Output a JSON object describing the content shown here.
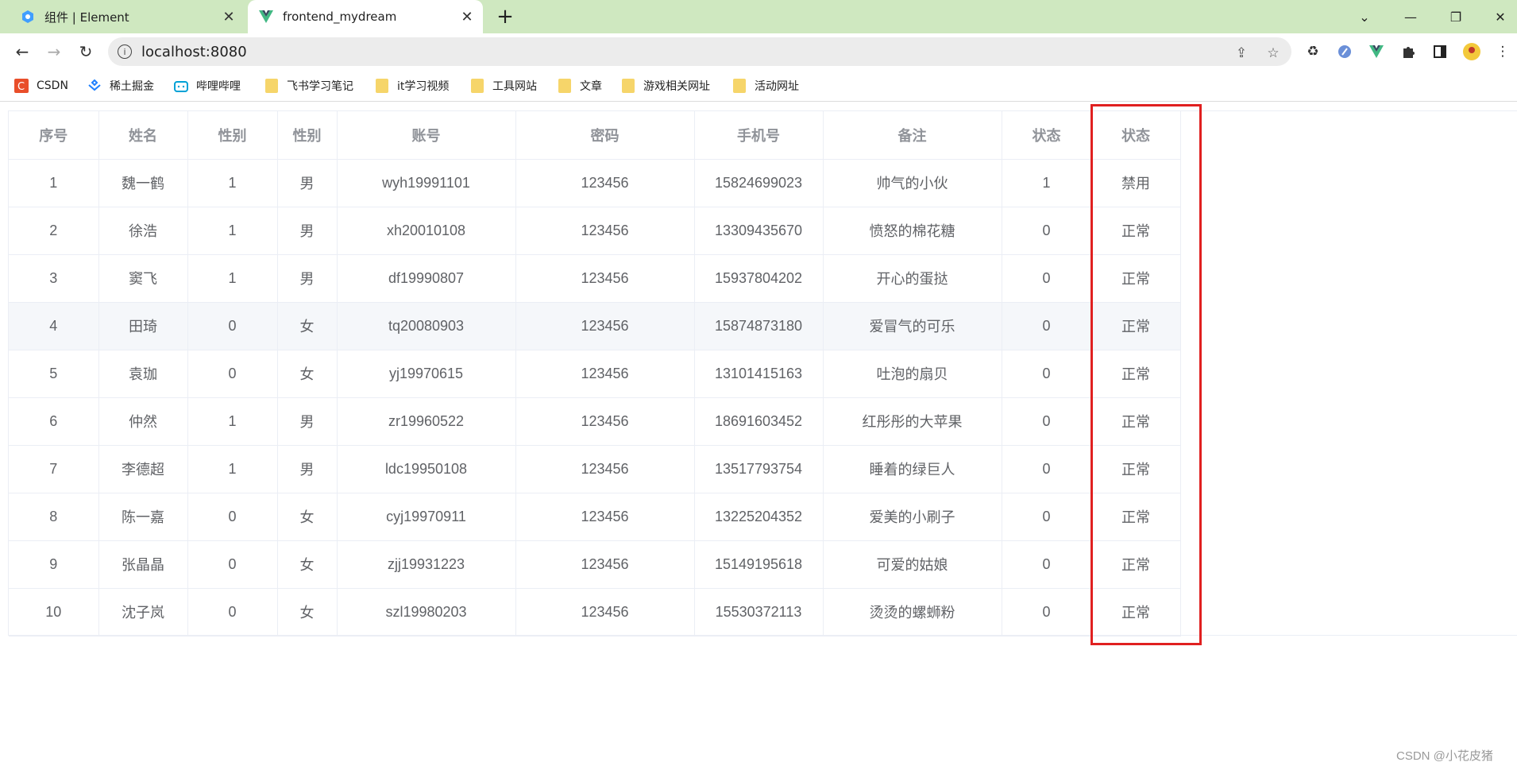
{
  "browser": {
    "tabs": [
      {
        "title": "组件 | Element",
        "close": "✕"
      },
      {
        "title": "frontend_mydream",
        "close": "✕"
      }
    ],
    "new_tab": "+",
    "window_controls": {
      "menu": "⌄",
      "minimize": "—",
      "restore": "❐",
      "close": "✕"
    },
    "nav": {
      "back": "←",
      "forward": "→",
      "reload": "↻"
    },
    "url": "localhost:8080",
    "bookmarks": [
      {
        "label": "CSDN",
        "icon": "csdn-icon"
      },
      {
        "label": "稀土掘金",
        "icon": "juejin-icon"
      },
      {
        "label": "哔哩哔哩",
        "icon": "bilibili-icon"
      },
      {
        "label": "飞书学习笔记",
        "icon": "folder-icon"
      },
      {
        "label": "it学习视频",
        "icon": "folder-icon"
      },
      {
        "label": "工具网站",
        "icon": "folder-icon"
      },
      {
        "label": "文章",
        "icon": "folder-icon"
      },
      {
        "label": "游戏相关网址",
        "icon": "folder-icon"
      },
      {
        "label": "活动网址",
        "icon": "folder-icon"
      }
    ],
    "accent": "#cfe8c0"
  },
  "table": {
    "headers": [
      "序号",
      "姓名",
      "性别",
      "性别",
      "账号",
      "密码",
      "手机号",
      "备注",
      "状态",
      "状态"
    ],
    "rows": [
      [
        "1",
        "魏一鹤",
        "1",
        "男",
        "wyh19991101",
        "123456",
        "15824699023",
        "帅气的小伙",
        "1",
        "禁用"
      ],
      [
        "2",
        "徐浩",
        "1",
        "男",
        "xh20010108",
        "123456",
        "13309435670",
        "愤怒的棉花糖",
        "0",
        "正常"
      ],
      [
        "3",
        "窦飞",
        "1",
        "男",
        "df19990807",
        "123456",
        "15937804202",
        "开心的蛋挞",
        "0",
        "正常"
      ],
      [
        "4",
        "田琦",
        "0",
        "女",
        "tq20080903",
        "123456",
        "15874873180",
        "爱冒气的可乐",
        "0",
        "正常"
      ],
      [
        "5",
        "袁珈",
        "0",
        "女",
        "yj19970615",
        "123456",
        "13101415163",
        "吐泡的扇贝",
        "0",
        "正常"
      ],
      [
        "6",
        "仲然",
        "1",
        "男",
        "zr19960522",
        "123456",
        "18691603452",
        "红彤彤的大苹果",
        "0",
        "正常"
      ],
      [
        "7",
        "李德超",
        "1",
        "男",
        "ldc19950108",
        "123456",
        "13517793754",
        "睡着的绿巨人",
        "0",
        "正常"
      ],
      [
        "8",
        "陈一嘉",
        "0",
        "女",
        "cyj19970911",
        "123456",
        "13225204352",
        "爱美的小刷子",
        "0",
        "正常"
      ],
      [
        "9",
        "张晶晶",
        "0",
        "女",
        "zjj19931223",
        "123456",
        "15149195618",
        "可爱的姑娘",
        "0",
        "正常"
      ],
      [
        "10",
        "沈子岚",
        "0",
        "女",
        "szl19980203",
        "123456",
        "15530372113",
        "烫烫的螺蛳粉",
        "0",
        "正常"
      ]
    ],
    "highlight_color": "#e02020"
  },
  "watermark": "CSDN @小花皮猪"
}
